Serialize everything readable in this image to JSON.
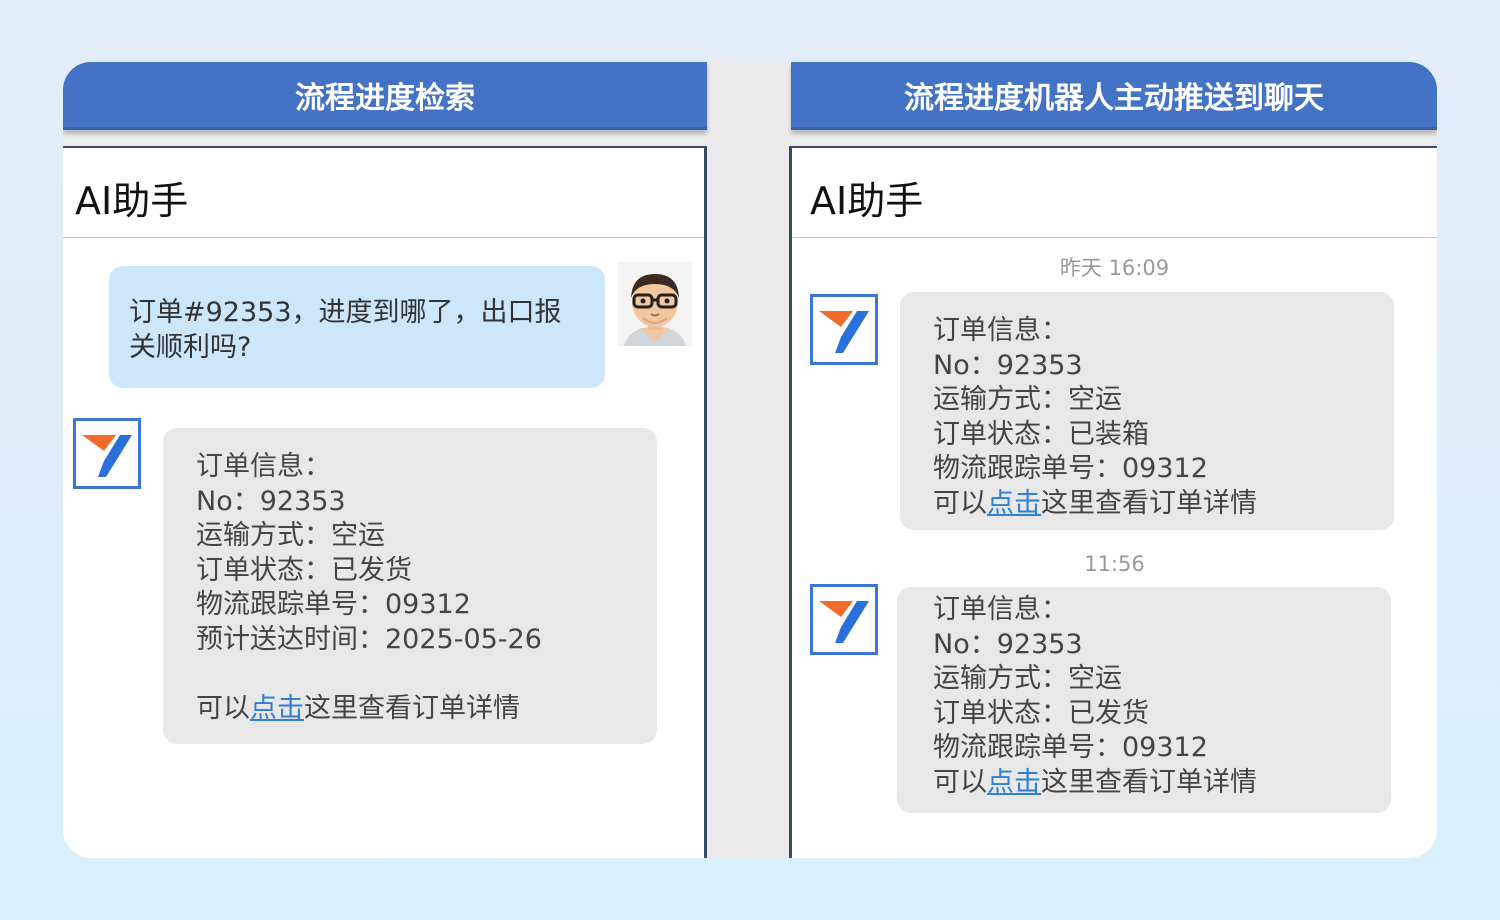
{
  "left_panel": {
    "header": "流程进度检索",
    "title": "AI助手",
    "user_message": [
      "订单#92353，进度到哪了，出口报",
      "关顺利吗?"
    ],
    "bot_message": {
      "lines": [
        "订单信息：",
        "No：92353",
        "运输方式：空运",
        "订单状态：已发货",
        "物流跟踪单号：09312",
        "预计送达时间：2025-05-26"
      ],
      "link_prefix": "可以",
      "link_text": "点击",
      "link_suffix": "这里查看订单详情"
    }
  },
  "right_panel": {
    "header": "流程进度机器人主动推送到聊天",
    "title": "AI助手",
    "messages": [
      {
        "timestamp": "昨天 16:09",
        "lines": [
          "订单信息：",
          "No：92353",
          "运输方式：空运",
          "订单状态：已装箱",
          "物流跟踪单号：09312"
        ],
        "link_prefix": "可以",
        "link_text": "点击",
        "link_suffix": "这里查看订单详情"
      },
      {
        "timestamp": "11:56",
        "lines": [
          "订单信息：",
          "No：92353",
          "运输方式：空运",
          "订单状态：已发货",
          "物流跟踪单号：09312"
        ],
        "link_prefix": "可以",
        "link_text": "点击",
        "link_suffix": "这里查看订单详情"
      }
    ]
  },
  "colors": {
    "header_blue": "#4472c4",
    "user_bubble": "#cce6fc",
    "bot_bubble": "#e8e8e8",
    "link": "#2f7ed8",
    "logo_orange": "#f26b2b",
    "logo_blue": "#2a6fdb"
  }
}
